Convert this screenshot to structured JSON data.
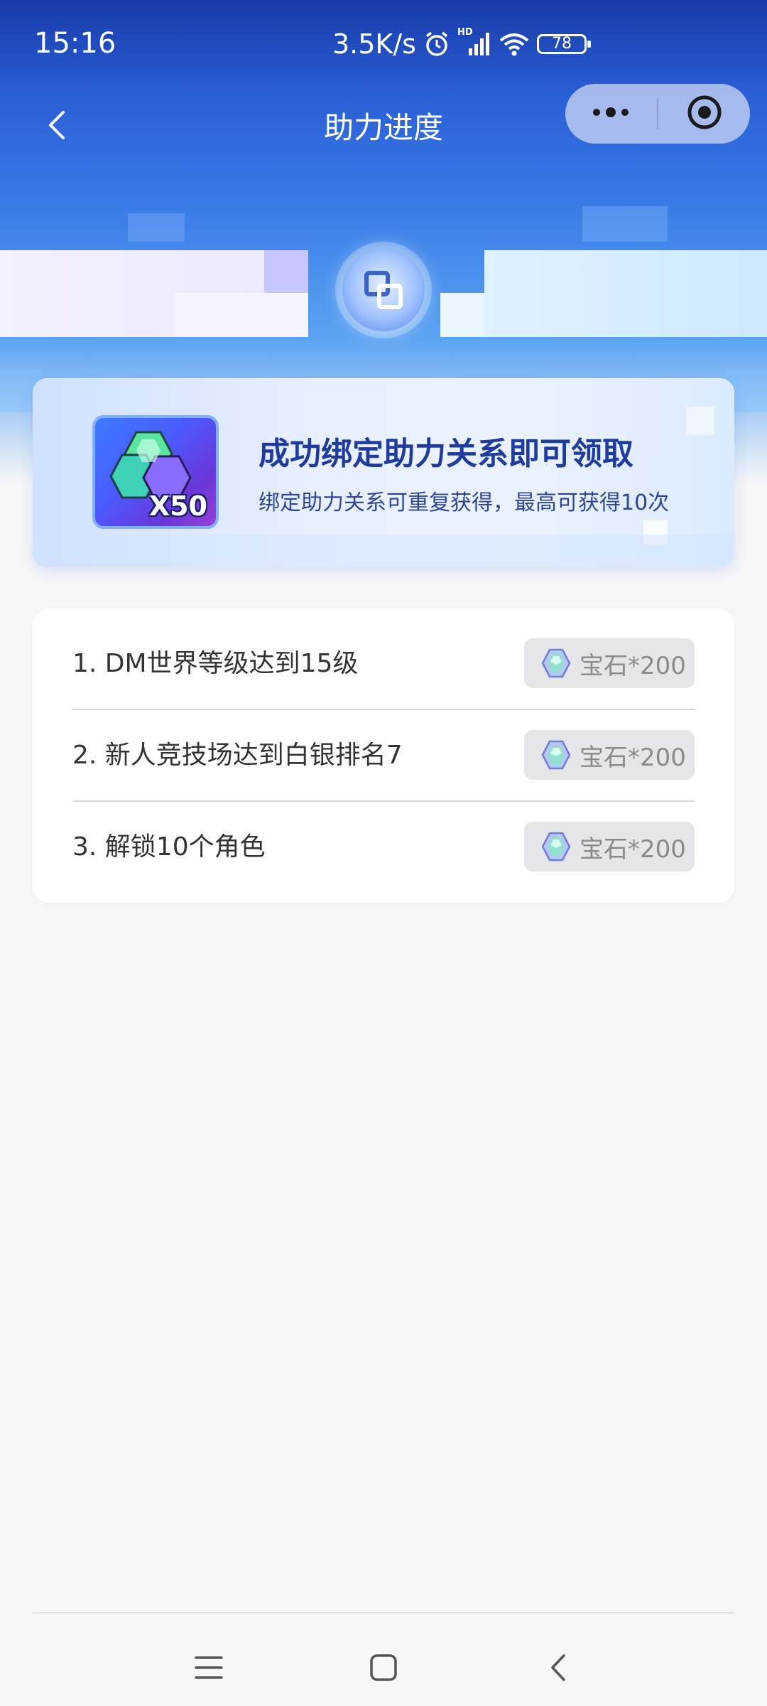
{
  "status_bar": {
    "time": "15:16",
    "net_speed": "3.5K/s",
    "network_badge": "HD",
    "battery": "78",
    "icons": [
      "alarm-icon",
      "signal-icon",
      "wifi-icon",
      "battery-icon"
    ]
  },
  "nav": {
    "title": "助力进度",
    "back_icon": "chevron-left-icon",
    "more_icon": "more-dots-icon",
    "close_icon": "target-close-icon"
  },
  "reward_banner": {
    "title": "成功绑定助力关系即可领取",
    "subtitle": "绑定助力关系可重复获得，最高可获得10次",
    "quantity": "X50",
    "image_icon": "gem-bundle-icon"
  },
  "tasks": [
    {
      "label": "1. DM世界等级达到15级",
      "reward": "宝石*200"
    },
    {
      "label": "2. 新人竞技场达到白银排名7",
      "reward": "宝石*200"
    },
    {
      "label": "3. 解锁10个角色",
      "reward": "宝石*200"
    }
  ],
  "system_nav": {
    "menu_icon": "menu-icon",
    "home_icon": "home-square-icon",
    "back_icon": "back-triangle-icon"
  },
  "colors": {
    "hero_top": "#1a3aa8",
    "hero_mid": "#3b7fe8",
    "banner_title": "#1e3b9e",
    "page_bg": "#f7f7f8"
  }
}
